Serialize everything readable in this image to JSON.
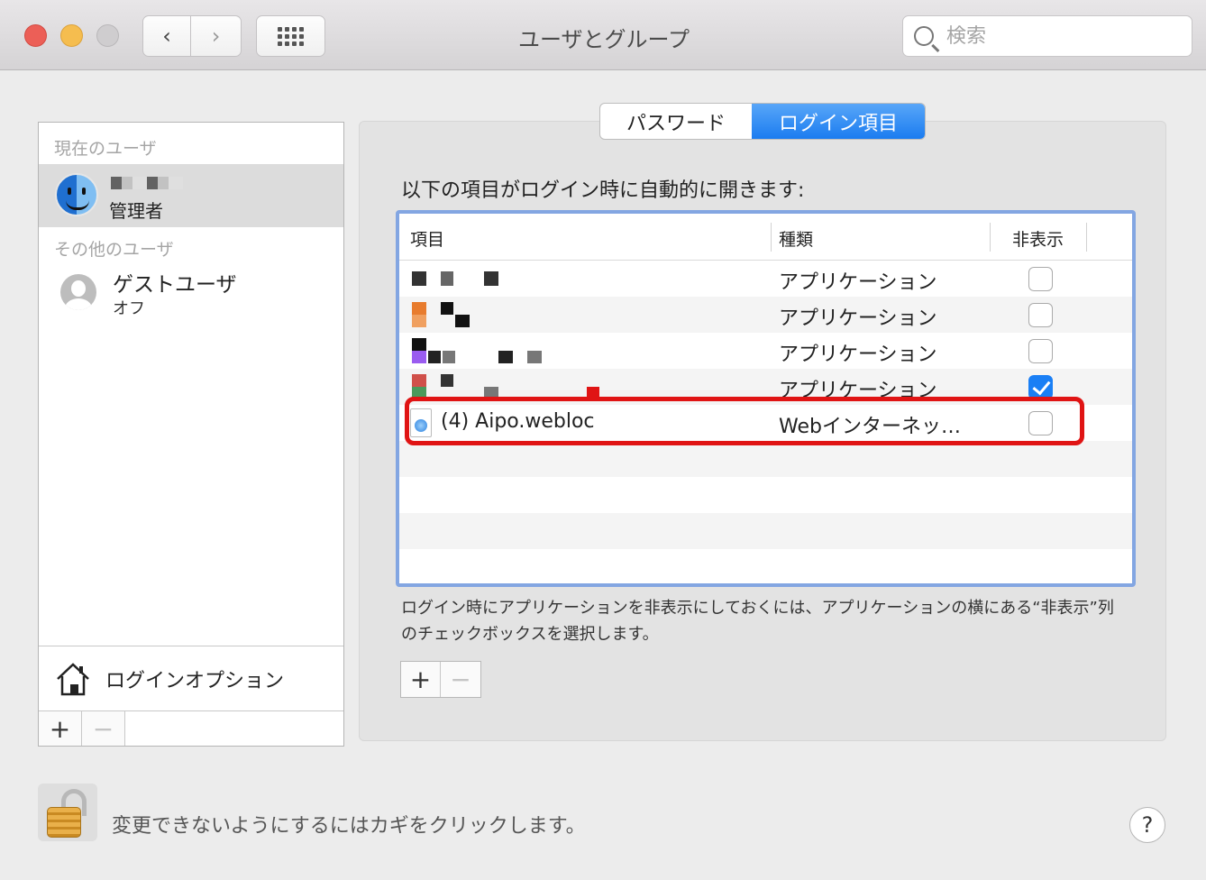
{
  "window": {
    "title": "ユーザとグループ"
  },
  "toolbar": {
    "back_glyph": "‹",
    "forward_glyph": "›",
    "search_placeholder": "検索"
  },
  "sidebar": {
    "current_header": "現在のユーザ",
    "current_user": {
      "role": "管理者",
      "avatar_icon": "finder-icon"
    },
    "other_header": "その他のユーザ",
    "guest_user": {
      "name": "ゲストユーザ",
      "status": "オフ"
    },
    "login_options_label": "ログインオプション",
    "add_label": "+",
    "remove_label": "−"
  },
  "tabs": [
    {
      "label": "パスワード",
      "active": false
    },
    {
      "label": "ログイン項目",
      "active": true
    }
  ],
  "login_items": {
    "description": "以下の項目がログイン時に自動的に開きます:",
    "columns": {
      "item": "項目",
      "kind": "種類",
      "hide": "非表示"
    },
    "rows": [
      {
        "name": "",
        "kind": "アプリケーション",
        "hidden": false
      },
      {
        "name": "",
        "kind": "アプリケーション",
        "hidden": false
      },
      {
        "name": "",
        "kind": "アプリケーション",
        "hidden": false
      },
      {
        "name": "",
        "kind": "アプリケーション",
        "hidden": true
      },
      {
        "name": "(4) Aipo.webloc",
        "kind": "Webインターネッ…",
        "hidden": false
      }
    ],
    "hint": "ログイン時にアプリケーションを非表示にしておくには、アプリケーションの横にある“非表示”列のチェックボックスを選択します。",
    "add_label": "+",
    "remove_label": "−"
  },
  "footer": {
    "lock_text": "変更できないようにするにはカギをクリックします。",
    "help_label": "?"
  },
  "colors": {
    "accent": "#1a7ff5",
    "highlight": "#e01414",
    "close": "#ec5f57",
    "minimize": "#f5bd4f"
  }
}
